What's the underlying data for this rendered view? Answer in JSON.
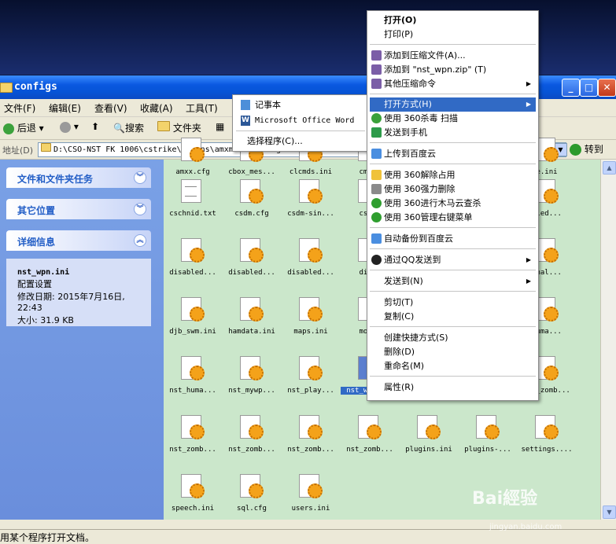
{
  "window": {
    "title": "configs",
    "menu": [
      "文件(F)",
      "编辑(E)",
      "查看(V)",
      "收藏(A)",
      "工具(T)"
    ],
    "title_buttons": [
      "_",
      "□",
      "✕"
    ]
  },
  "toolbar": {
    "back": "后退",
    "search": "搜索",
    "folders": "文件夹"
  },
  "address": {
    "label": "地址(D)",
    "path": "D:\\CSO-NST FK 1006\\cstrike\\addons\\amxmodx\\configs",
    "go": "转到"
  },
  "left_pane": {
    "tasks": "文件和文件夹任务",
    "other": "其它位置",
    "details": "详细信息",
    "detail_name": "nst_wpn.ini",
    "detail_type": "配置设置",
    "detail_modified": "修改日期: 2015年7月16日, 22:43",
    "detail_size": "大小: 31.9 KB"
  },
  "files": [
    {
      "name": "amxx.cfg"
    },
    {
      "name": "cbox_mes..."
    },
    {
      "name": "clcmds.ini"
    },
    {
      "name": "cmdac"
    },
    {
      "name": "e.ini"
    },
    {
      "name": "cschnid.txt",
      "type": "txt"
    },
    {
      "name": "csdm.cfg"
    },
    {
      "name": "csdm-sin..."
    },
    {
      "name": "csold"
    },
    {
      "name": "bled..."
    },
    {
      "name": "disabled..."
    },
    {
      "name": "disabled..."
    },
    {
      "name": "disabled..."
    },
    {
      "name": "disab"
    },
    {
      "name": "Chal..."
    },
    {
      "name": "djb_swm.ini"
    },
    {
      "name": "hamdata.ini"
    },
    {
      "name": "maps.ini"
    },
    {
      "name": "modul"
    },
    {
      "name": "huma..."
    },
    {
      "name": "nst_huma..."
    },
    {
      "name": "nst_mywp..."
    },
    {
      "name": "nst_play..."
    },
    {
      "name": "nst_wpn.ini",
      "selected": true
    },
    {
      "name": "nst_zomb..."
    },
    {
      "name": "nst_zomb..."
    },
    {
      "name": "nst_zomb..."
    },
    {
      "name": "nst_zomb..."
    },
    {
      "name": "nst_zomb..."
    },
    {
      "name": "nst_zomb..."
    },
    {
      "name": "nst_zomb..."
    },
    {
      "name": "plugins.ini"
    },
    {
      "name": "plugins-..."
    },
    {
      "name": "settings...."
    },
    {
      "name": "speech.ini"
    },
    {
      "name": "sql.cfg"
    },
    {
      "name": "users.ini"
    }
  ],
  "status": "用某个程序打开文档。",
  "context_menu": {
    "open": "打开(O)",
    "print": "打印(P)",
    "add_archive": "添加到压缩文件(A)...",
    "add_zip": "添加到 \"nst_wpn.zip\" (T)",
    "other_zip": "其他压缩命令",
    "open_with": "打开方式(H)",
    "scan360": "使用 360杀毒 扫描",
    "send_phone": "发送到手机",
    "baidu_upload": "上传到百度云",
    "unlock360": "使用 360解除占用",
    "delete360": "使用 360强力删除",
    "trojan360": "使用 360进行木马云查杀",
    "rightmenu360": "使用 360管理右键菜单",
    "autobackup": "自动备份到百度云",
    "qq_send": "通过QQ发送到",
    "send_to": "发送到(N)",
    "cut": "剪切(T)",
    "copy": "复制(C)",
    "shortcut": "创建快捷方式(S)",
    "delete": "删除(D)",
    "rename": "重命名(M)",
    "properties": "属性(R)"
  },
  "submenu": {
    "notepad": "记事本",
    "word": "Microsoft Office Word",
    "choose": "选择程序(C)..."
  },
  "watermark": {
    "brand": "Bai經验",
    "site": "jingyan.baidu.com"
  }
}
